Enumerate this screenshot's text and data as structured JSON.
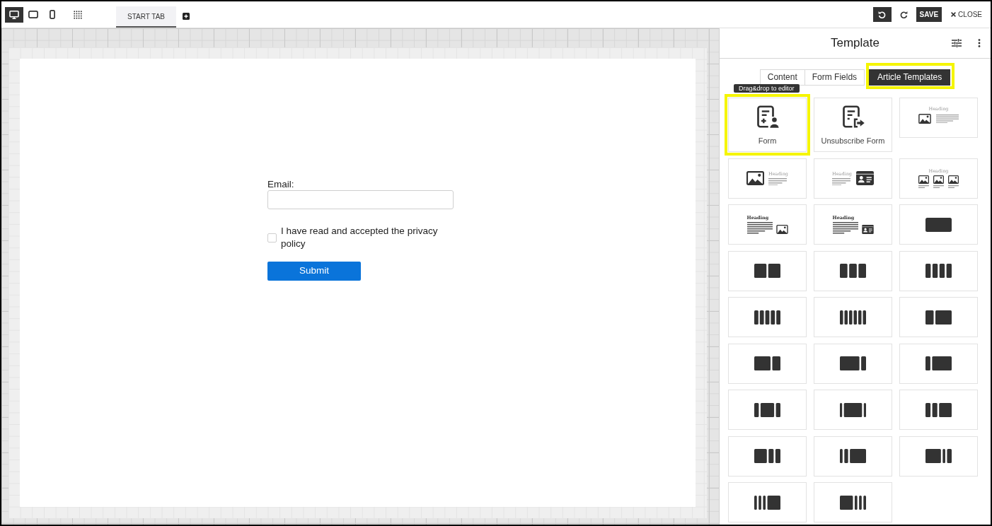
{
  "toolbar": {
    "devices": [
      {
        "kind": "desktop",
        "selected": true
      },
      {
        "kind": "tablet",
        "selected": false
      },
      {
        "kind": "mobile",
        "selected": false
      }
    ],
    "tabs": [
      {
        "label": "START TAB",
        "selected": true
      }
    ],
    "save_button": "SAVE",
    "close_button": "CLOSE"
  },
  "canvas": {
    "form": {
      "email_label": "Email:",
      "consent": {
        "label": "I have read and accepted the privacy policy",
        "checked": false
      },
      "submit_button": "Submit"
    }
  },
  "panel": {
    "title": "Template",
    "tabs": [
      {
        "label": "Content",
        "selected": false,
        "highlighted": false
      },
      {
        "label": "Form Fields",
        "selected": false,
        "highlighted": false
      },
      {
        "label": "Article Templates",
        "selected": true,
        "highlighted": true
      }
    ],
    "tooltip": "Drag&drop to editor",
    "tiles": [
      {
        "kind": "form",
        "label": "Form",
        "highlighted": true
      },
      {
        "kind": "unsubscribe",
        "label": "Unsubscribe Form",
        "highlighted": false
      },
      {
        "kind": "heading-media",
        "heading": "Heading",
        "highlighted": false
      },
      {
        "kind": "media-text",
        "heading": "Heading",
        "highlighted": false
      },
      {
        "kind": "text-card",
        "heading": "Heading",
        "highlighted": false
      },
      {
        "kind": "gallery",
        "heading": "Heading",
        "highlighted": false
      },
      {
        "kind": "text-media",
        "heading": "Heading",
        "highlighted": false
      },
      {
        "kind": "text-card-small",
        "heading": "Heading",
        "highlighted": false
      },
      {
        "kind": "full",
        "highlighted": false
      },
      {
        "kind": "halves",
        "highlighted": false
      },
      {
        "kind": "thirds",
        "highlighted": false
      },
      {
        "kind": "quarters",
        "highlighted": false
      },
      {
        "kind": "fifths",
        "highlighted": false
      },
      {
        "kind": "sixths",
        "highlighted": false
      },
      {
        "kind": "narrow-wide",
        "highlighted": false
      },
      {
        "kind": "wide-narrow",
        "highlighted": false
      },
      {
        "kind": "wide-thin",
        "highlighted": false
      },
      {
        "kind": "thin-wide",
        "highlighted": false
      },
      {
        "kind": "narrow-wide-narrow",
        "highlighted": false
      },
      {
        "kind": "thin-wide-thin",
        "highlighted": false
      },
      {
        "kind": "narrow-narrow-wide",
        "highlighted": false
      },
      {
        "kind": "wide-narrow-narrow",
        "highlighted": false
      },
      {
        "kind": "thin-thin-wide",
        "highlighted": false
      },
      {
        "kind": "wide-thin-thin",
        "highlighted": false
      },
      {
        "kind": "thin-thin-thin-wide",
        "highlighted": false
      },
      {
        "kind": "wide-thin-thin-thin",
        "highlighted": false
      }
    ]
  }
}
